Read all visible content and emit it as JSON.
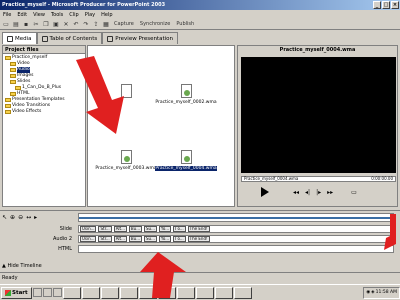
{
  "window": {
    "title": "Practice_myself - Microsoft Producer for PowerPoint 2003"
  },
  "menu": [
    "File",
    "Edit",
    "View",
    "Tools",
    "Clip",
    "Play",
    "Help"
  ],
  "toolbar": {
    "capture": "Capture",
    "synchronize": "Synchronize",
    "publish": "Publish"
  },
  "tabs": [
    "Media",
    "Table of Contents",
    "Preview Presentation"
  ],
  "left_pane": {
    "header": "Project files",
    "tree": [
      "Practice_myself",
      "Video",
      "Audio",
      "Images",
      "Slides",
      "1_Can_Do_B_Plus",
      "HTML",
      "Presentation Templates",
      "Video Transitions",
      "Video Effects"
    ]
  },
  "files": [
    {
      "name": "",
      "icon": "blank-doc"
    },
    {
      "name": "Practice_myself_0002.wma",
      "icon": "media-doc"
    },
    {
      "name": "Practice_myself_0003.wma",
      "icon": "media-doc"
    },
    {
      "name": "Practice_myself_0004.wma",
      "icon": "media-doc"
    }
  ],
  "preview": {
    "title": "Practice_myself_0004.wma",
    "filename": "Practice_myself_0004.wma",
    "time": "0:00:00.00"
  },
  "timeline": {
    "tracks": [
      {
        "label": "Slide",
        "clips": [
          "Usin...",
          "Str...",
          "Alt...",
          "Bu...",
          "Su...",
          "Yo...",
          "I o...",
          "The End!"
        ]
      },
      {
        "label": "Audio 2",
        "clips": [
          "Usin...",
          "Str...",
          "Alt...",
          "Bu...",
          "Su...",
          "Yo...",
          "I o...",
          "The End!"
        ]
      },
      {
        "label": "HTML",
        "clips": []
      }
    ],
    "hide": "Hide Timeline"
  },
  "status": "Ready",
  "taskbar": {
    "start": "Start",
    "clock": "11:58 AM"
  }
}
